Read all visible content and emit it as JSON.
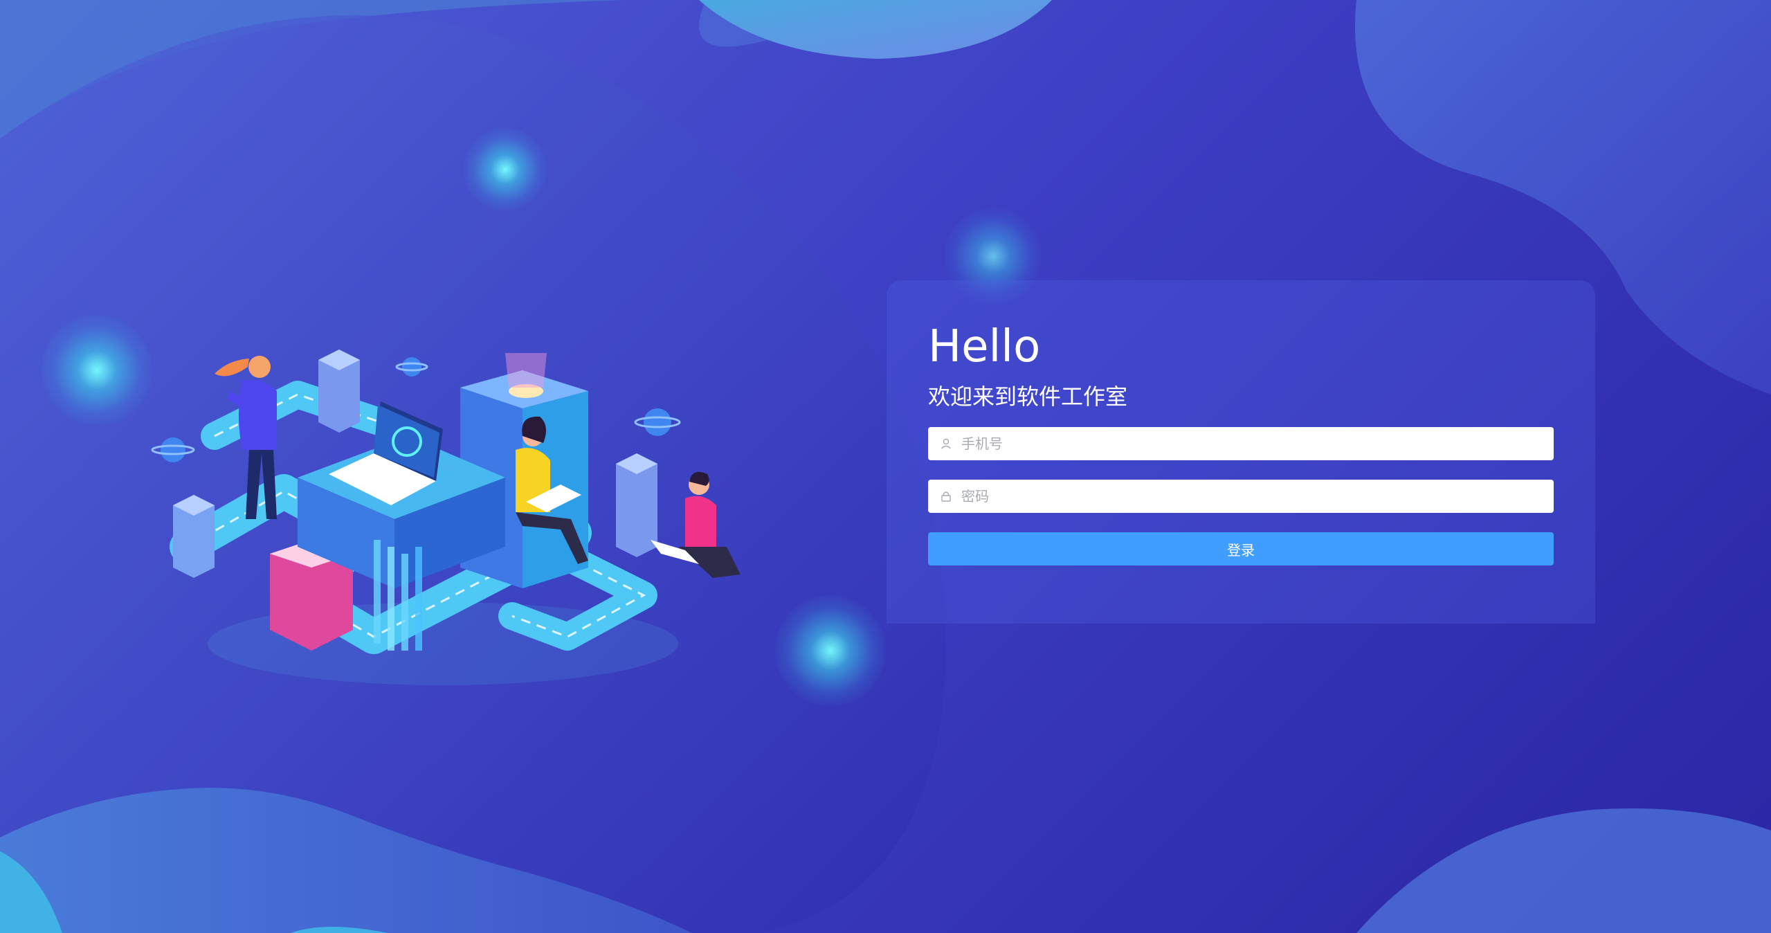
{
  "login": {
    "greeting": "Hello",
    "welcome": "欢迎来到软件工作室",
    "phone_placeholder": "手机号",
    "password_placeholder": "密码",
    "submit_label": "登录"
  },
  "icons": {
    "phone_field_icon": "user-icon",
    "password_field_icon": "lock-icon"
  },
  "colors": {
    "button": "#409eff",
    "background": "#3d3fc4",
    "glow": "#5ff0f5"
  }
}
